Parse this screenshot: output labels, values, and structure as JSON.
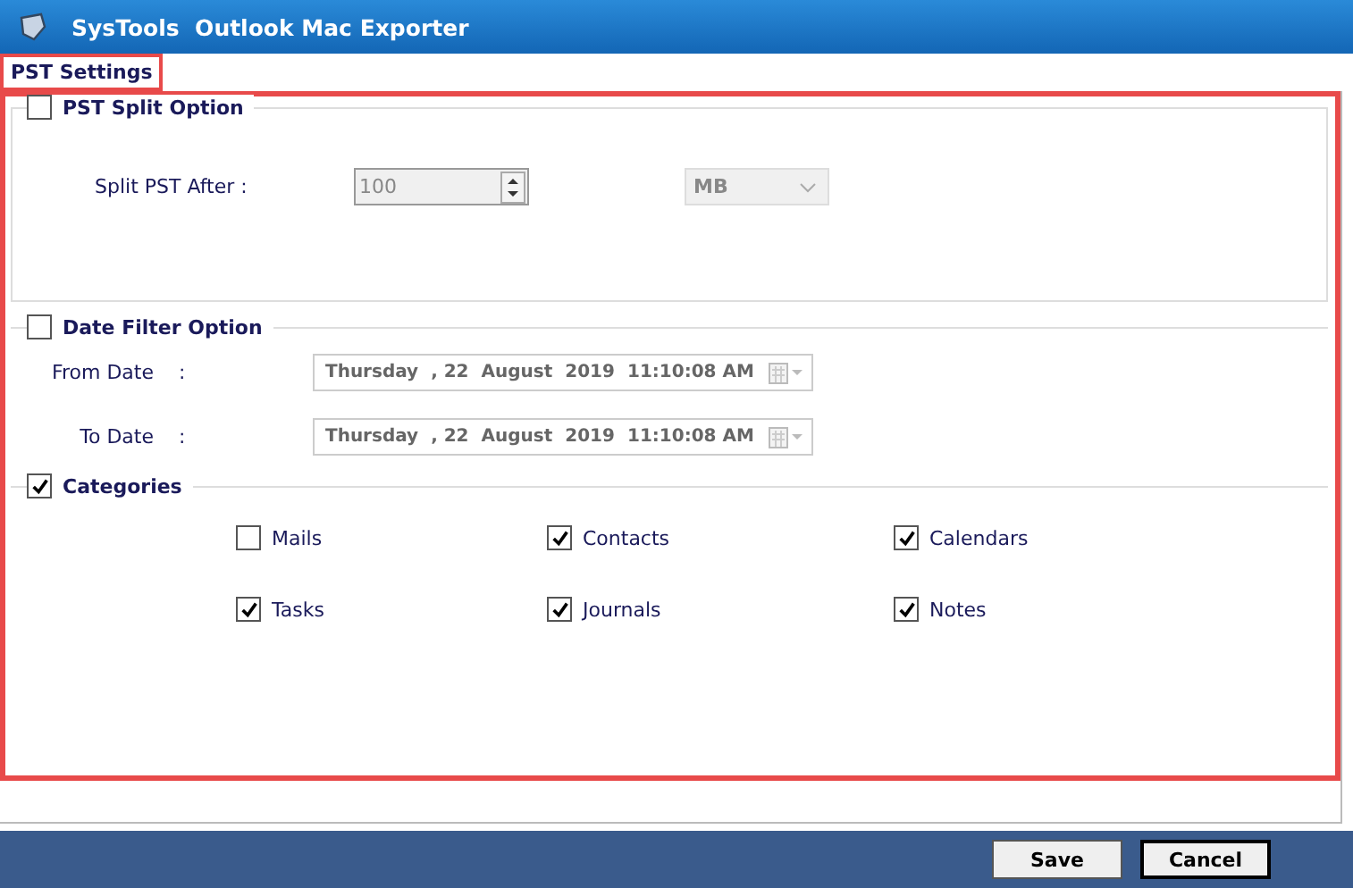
{
  "window": {
    "title": "SysTools  Outlook Mac Exporter"
  },
  "tabs": [
    {
      "label": "PST Settings",
      "selected": true
    }
  ],
  "split": {
    "label": "PST Split Option",
    "checked": false,
    "field_label": "Split PST After :",
    "value": "100",
    "unit": "MB",
    "disabled": true
  },
  "date_filter": {
    "label": "Date Filter Option",
    "checked": false,
    "disabled": true,
    "rows": [
      {
        "label": "From Date",
        "colon": ":",
        "parts": [
          "Thursday",
          ", 22",
          "August",
          "2019",
          "11:10:08 AM"
        ]
      },
      {
        "label": "To Date",
        "colon": ":",
        "parts": [
          "Thursday",
          ", 22",
          "August",
          "2019",
          "11:10:08 AM"
        ]
      }
    ]
  },
  "categories": {
    "label": "Categories",
    "checked": true,
    "items": [
      {
        "label": "Mails",
        "checked": false
      },
      {
        "label": "Contacts",
        "checked": true
      },
      {
        "label": "Calendars",
        "checked": true
      },
      {
        "label": "Tasks",
        "checked": true
      },
      {
        "label": "Journals",
        "checked": true
      },
      {
        "label": "Notes",
        "checked": true
      }
    ]
  },
  "buttons": [
    {
      "label": "Save",
      "focused": false
    },
    {
      "label": "Cancel",
      "focused": true
    }
  ]
}
